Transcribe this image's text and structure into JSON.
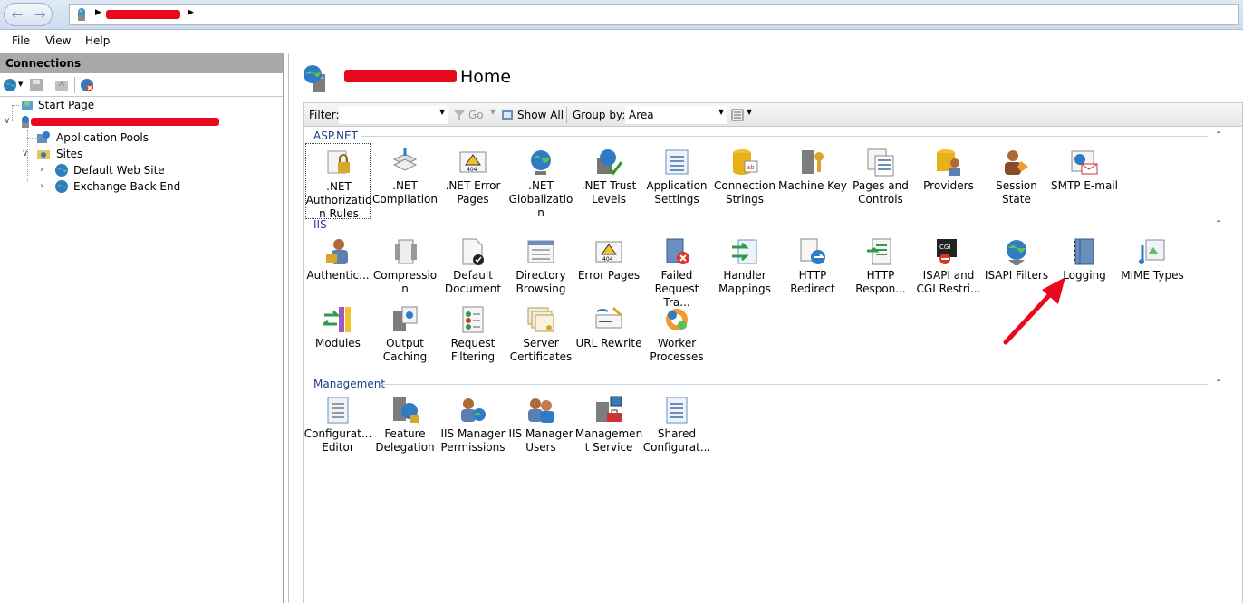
{
  "menu": {
    "file": "File",
    "view": "View",
    "help": "Help"
  },
  "connections": {
    "title": "Connections",
    "tree": {
      "start_page": "Start Page",
      "app_pools": "Application Pools",
      "sites": "Sites",
      "default_site": "Default Web Site",
      "exchange_site": "Exchange Back End"
    }
  },
  "main": {
    "title": "Home",
    "filter": {
      "filter_label": "Filter:",
      "go_label": "Go",
      "show_all_label": "Show All",
      "group_by_label": "Group by:",
      "group_by_value": "Area"
    },
    "groups": [
      {
        "name": "ASP.NET",
        "items": [
          ".NET Authorization Rules",
          ".NET Compilation",
          ".NET Error Pages",
          ".NET Globalization",
          ".NET Trust Levels",
          "Application Settings",
          "Connection Strings",
          "Machine Key",
          "Pages and Controls",
          "Providers",
          "Session State",
          "SMTP E-mail"
        ]
      },
      {
        "name": "IIS",
        "items": [
          "Authentic...",
          "Compression",
          "Default Document",
          "Directory Browsing",
          "Error Pages",
          "Failed Request Tra...",
          "Handler Mappings",
          "HTTP Redirect",
          "HTTP Respon...",
          "ISAPI and CGI Restri...",
          "ISAPI Filters",
          "Logging",
          "MIME Types",
          "Modules",
          "Output Caching",
          "Request Filtering",
          "Server Certificates",
          "URL Rewrite",
          "Worker Processes"
        ]
      },
      {
        "name": "Management",
        "items": [
          "Configurat... Editor",
          "Feature Delegation",
          "IIS Manager Permissions",
          "IIS Manager Users",
          "Management Service",
          "Shared Configurat..."
        ]
      }
    ]
  },
  "colors": {
    "annotation_arrow": "#e8091f",
    "group_header": "#1e3f8a"
  }
}
